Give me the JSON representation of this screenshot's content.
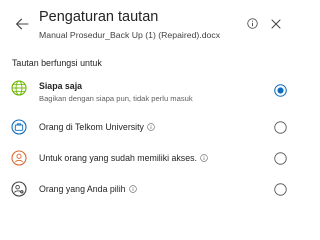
{
  "header": {
    "title": "Pengaturan tautan",
    "filename": "Manual Prosedur_Back Up (1) (Repaired).docx",
    "back_icon": "arrow-left-icon",
    "info_icon": "info-icon",
    "close_icon": "close-icon"
  },
  "section": {
    "label": "Tautan berfungsi untuk"
  },
  "options": [
    {
      "label": "Siapa saja",
      "description": "Bagikan dengan siapa pun, tidak perlu masuk",
      "icon": "globe-icon",
      "selected": true
    },
    {
      "label": "Orang di Telkom University",
      "icon": "organization-icon",
      "has_info": true,
      "selected": false
    },
    {
      "label": "Untuk orang yang sudah memiliki akses.",
      "icon": "person-icon",
      "has_info": true,
      "selected": false
    },
    {
      "label": "Orang yang Anda pilih",
      "icon": "people-settings-icon",
      "has_info": true,
      "selected": false
    }
  ],
  "colors": {
    "accent": "#0f6cbd",
    "globe": "#6bb700",
    "organization": "#0f6cbd",
    "person": "#d86b2f",
    "text": "#242424",
    "secondary_text": "#616161",
    "radio_border": "#616161"
  }
}
